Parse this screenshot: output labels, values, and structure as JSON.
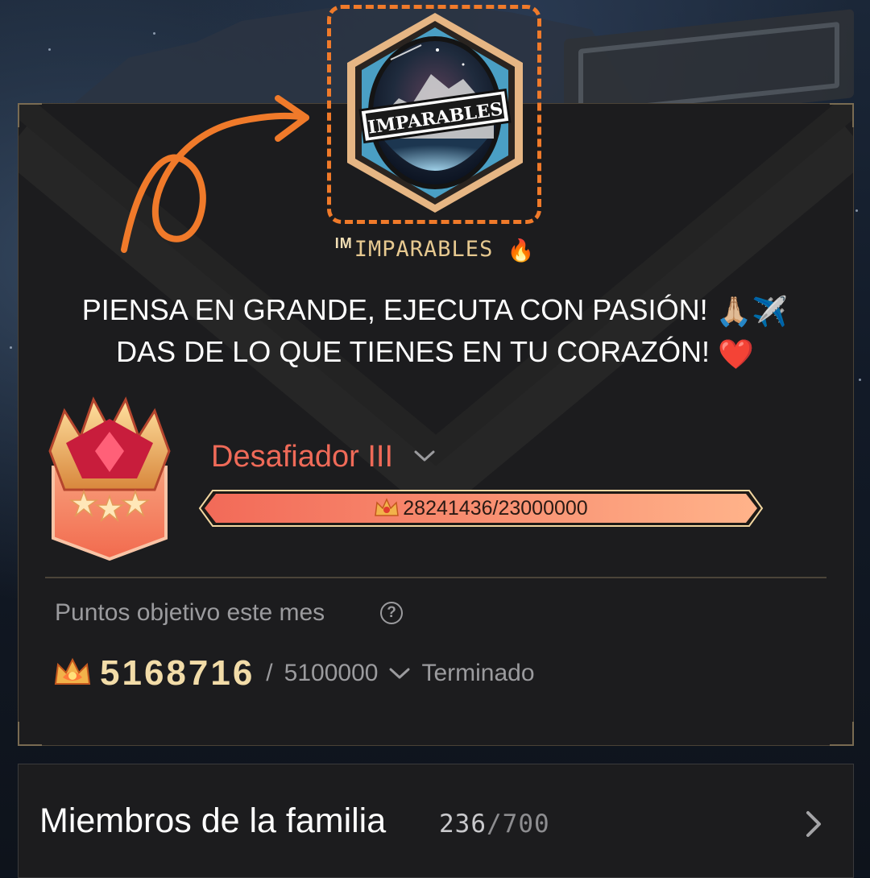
{
  "family": {
    "emblem_text": "IMPARABLES",
    "name_prefix": "IM",
    "name": "IMPARABLES",
    "name_emoji": "🔥",
    "motto_line1": "PIENSA EN GRANDE, EJECUTA CON PASIÓN!",
    "motto_line1_emoji": "🙏🏼✈️",
    "motto_line2": "DAS DE LO QUE TIENES EN TU CORAZÓN!",
    "motto_line2_emoji": "❤️"
  },
  "rank": {
    "title": "Desafiador III",
    "progress_text": "28241436/23000000",
    "progress_value": 28241436,
    "progress_max": 23000000,
    "progress_fraction": 1.0
  },
  "monthly": {
    "label": "Puntos objetivo este mes",
    "help_icon": "?",
    "points": "5168716",
    "separator": "/",
    "goal": "5100000",
    "status": "Terminado"
  },
  "members": {
    "title": "Miembros de la familia",
    "current": "236",
    "separator": "/",
    "max": "700"
  },
  "colors": {
    "accent_orange": "#f07a2a",
    "rank_title": "#ef6a58",
    "points_gold": "#f2dca8",
    "card_bg": "#1c1c1e"
  },
  "icons": {
    "emblem": "family-emblem-icon",
    "arrow": "annotation-arrow-icon",
    "rank_badge": "challenger-rank-badge-icon",
    "crown": "crown-icon",
    "help": "question-circle-icon",
    "chevron_down": "chevron-down-icon",
    "chevron_right": "chevron-right-icon"
  }
}
